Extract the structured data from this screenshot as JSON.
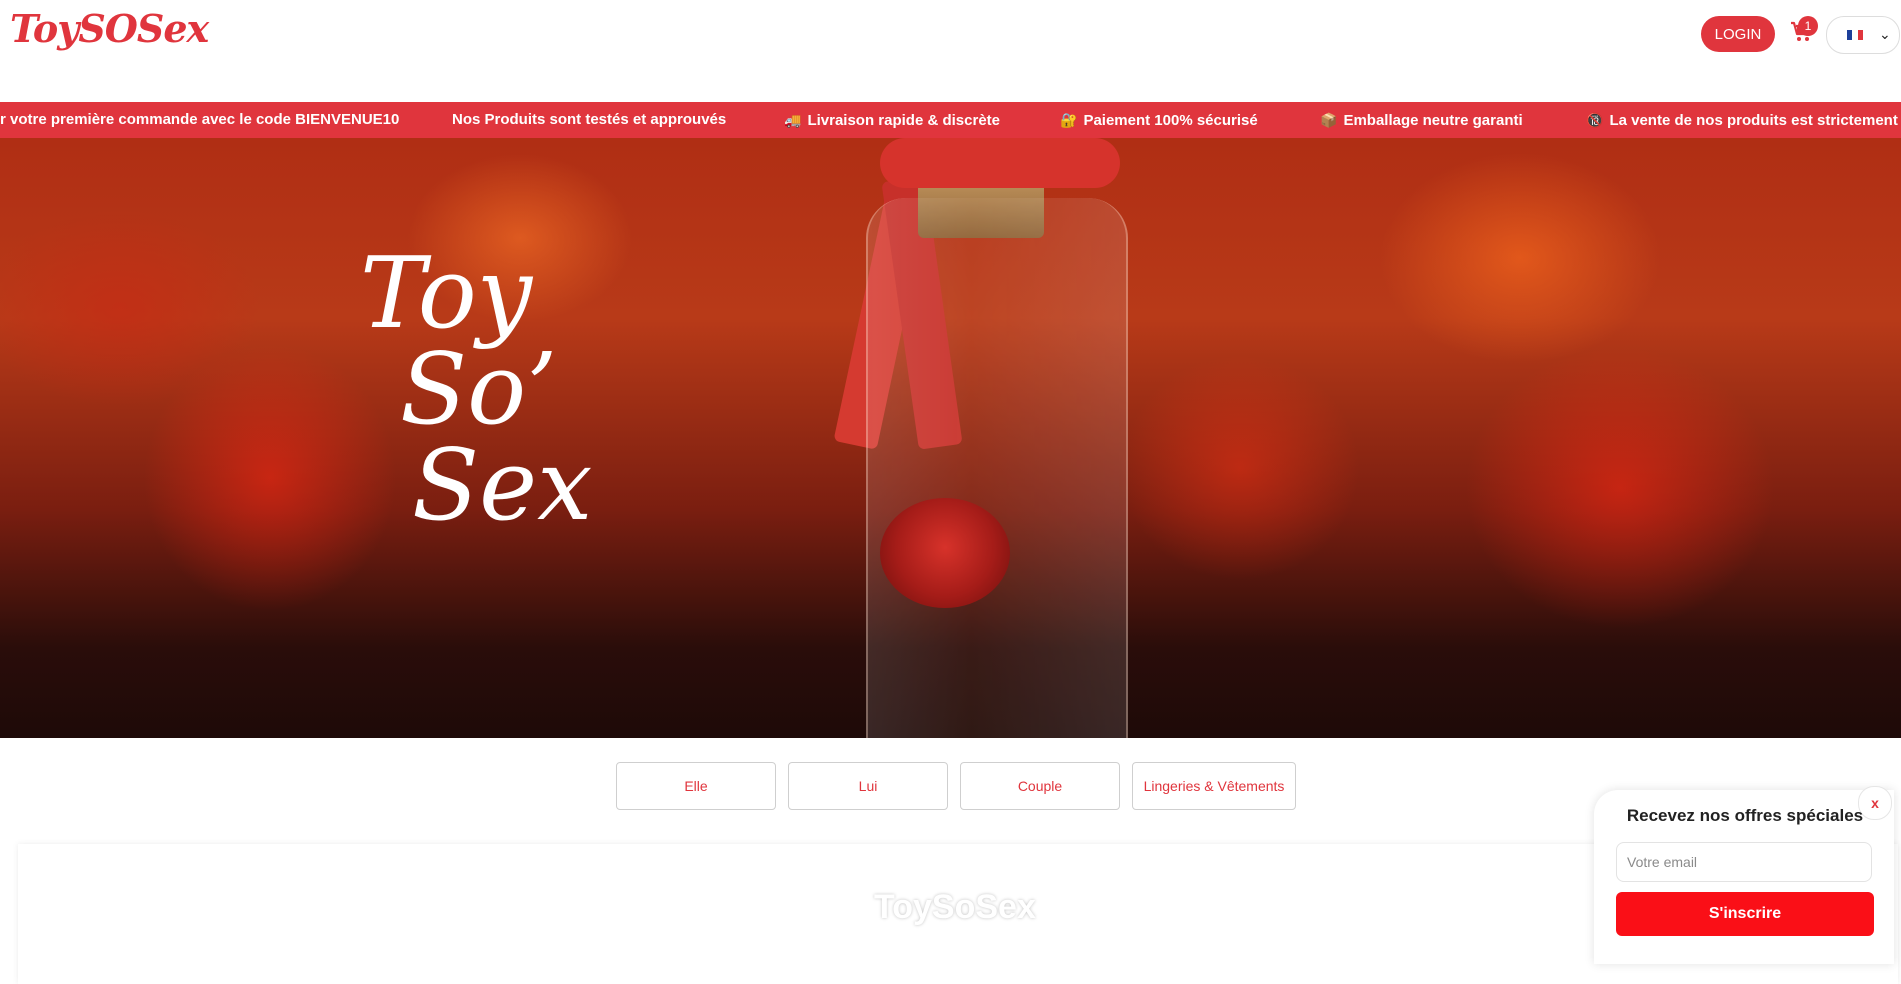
{
  "header": {
    "logo_text": "ToySOSex",
    "login_label": "LOGIN",
    "cart_count": "1",
    "language_flag": "fr-flag"
  },
  "ticker": {
    "items": [
      {
        "icon": "",
        "text": "r votre première commande avec le code BIENVENUE10"
      },
      {
        "icon": "",
        "text": "Nos Produits sont testés et approuvés"
      },
      {
        "icon": "🚚",
        "text": "Livraison rapide & discrète"
      },
      {
        "icon": "🔐",
        "text": "Paiement 100% sécurisé"
      },
      {
        "icon": "📦",
        "text": "Emballage neutre garanti"
      },
      {
        "icon": "🔞",
        "text": "La vente de nos produits est strictement i"
      }
    ]
  },
  "hero": {
    "title_lines": [
      "Toy",
      "So’",
      "Sex"
    ]
  },
  "categories": [
    "Elle",
    "Lui",
    "Couple",
    "Lingeries & Vêtements"
  ],
  "content": {
    "watermark": "ToySoSex"
  },
  "newsletter": {
    "close_label": "x",
    "title": "Recevez nos offres spéciales",
    "email_placeholder": "Votre email",
    "submit_label": "S'inscrire"
  },
  "colors": {
    "accent": "#e0353d",
    "submit": "#fa0f17"
  }
}
